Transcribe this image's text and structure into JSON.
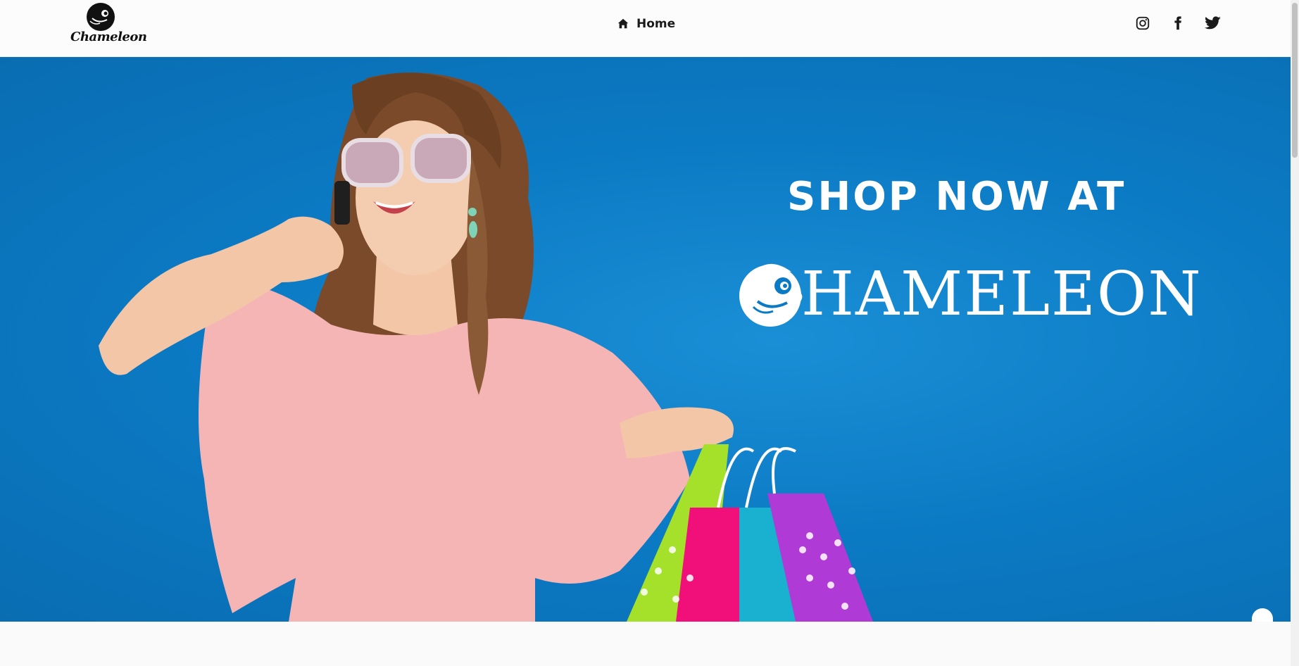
{
  "header": {
    "logo_text": "Chameleon",
    "nav": {
      "home_label": "Home",
      "home_icon": "home-icon"
    },
    "social": [
      {
        "name": "instagram",
        "icon": "instagram-icon"
      },
      {
        "name": "facebook",
        "icon": "facebook-icon"
      },
      {
        "name": "twitter",
        "icon": "twitter-icon"
      }
    ]
  },
  "hero": {
    "headline": "SHOP NOW AT",
    "brand_wordmark": "HAMELEON",
    "background_color": "#0b7ac4",
    "carousel": {
      "slide_count": 3,
      "active_slide": 3
    }
  },
  "colors": {
    "accent_blue": "#0b7ac4",
    "text_dark": "#1a1a1a",
    "white": "#ffffff"
  }
}
